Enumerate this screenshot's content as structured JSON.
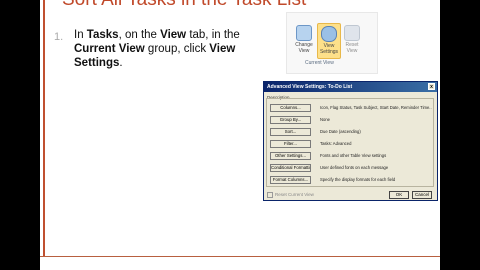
{
  "slide": {
    "title": "Sort All Tasks in the Task List",
    "step_number": "1.",
    "step": {
      "t1": "In ",
      "b1": "Tasks",
      "t2": ", on the ",
      "b2": "View",
      "t3": " tab, in the ",
      "b3": "Current View",
      "t4": " group, click ",
      "b4": "View Settings",
      "t5": "."
    }
  },
  "ribbon": {
    "change_view": "Change View",
    "view_settings": "View Settings",
    "reset_view": "Reset View",
    "group_label": "Current View"
  },
  "dialog": {
    "title": "Advanced View Settings: To-Do List",
    "close": "x",
    "description_label": "Description",
    "rows": [
      {
        "button": "Columns...",
        "value": "Icon, Flag Status, Task Subject, Start Date, Reminder Time..."
      },
      {
        "button": "Group By...",
        "value": "None"
      },
      {
        "button": "Sort...",
        "value": "Due Date (ascending)"
      },
      {
        "button": "Filter...",
        "value": "Tasks: Advanced"
      },
      {
        "button": "Other Settings...",
        "value": "Fonts and other Table View settings"
      },
      {
        "button": "Conditional Formatting...",
        "value": "User defined fonts on each message"
      },
      {
        "button": "Format Columns...",
        "value": "Specify the display formats for each field"
      }
    ],
    "reset_label": "Reset Current View",
    "ok": "OK",
    "cancel": "Cancel"
  }
}
